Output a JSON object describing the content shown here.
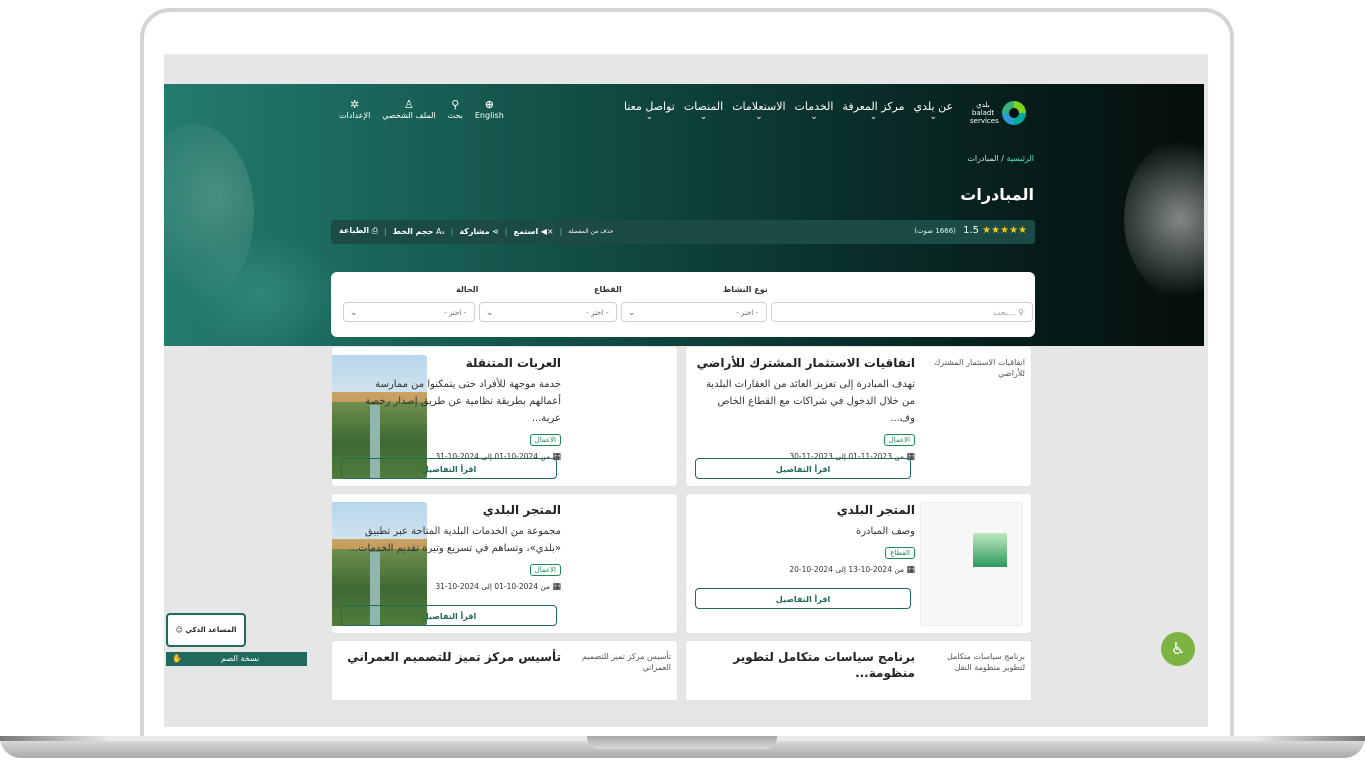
{
  "header": {
    "logo_text": "بلدي baladt services",
    "nav": [
      {
        "label": "عن بلدي"
      },
      {
        "label": "مركز المعرفة"
      },
      {
        "label": "الخدمات"
      },
      {
        "label": "الاستعلامات"
      },
      {
        "label": "المنصات"
      },
      {
        "label": "تواصل معنا"
      }
    ],
    "tools": {
      "language": "English",
      "search": "بحث",
      "profile": "الملف الشخصي",
      "settings": "الإعدادات"
    }
  },
  "breadcrumb": {
    "home": "الرئيسية",
    "separator": "/",
    "current": "المبادرات"
  },
  "page_title": "المبادرات",
  "rating": {
    "stars": "★★★★★",
    "score": "1.5",
    "votes": "(1666 صوت)"
  },
  "actions": {
    "favorite": "حذف من المفضلة",
    "listen": "استمع",
    "share": "مشاركة",
    "font_size": "حجم الخط",
    "print": "الطباعة"
  },
  "filter": {
    "search_placeholder": "بحث...",
    "activity_label": "نوع النشاط",
    "activity_value": "- اختر -",
    "sector_label": "القطاع",
    "sector_value": "- اختر -",
    "status_label": "الحالة",
    "status_value": "- اختر -"
  },
  "cards": [
    {
      "title": "اتفاقيات الاستثمار المشترك للأراضي",
      "desc": "تهدف المبادرة إلى تعزيز العائد من العقارات البلدية من خلال الدخول في شراكات مع القطاع الخاص وف...",
      "tag": "الاعمال",
      "dates": "من 2023-11-01 إلى 2023-11-30",
      "button": "اقرأ التفاصيل",
      "image_alt": "اتفاقيات الاستثمار المشترك للأراضي"
    },
    {
      "title": "العربات المتنقلة",
      "desc": "خدمة موجهة للأفراد حتى يتمكنوا من ممارسة أعمالهم بطريقة نظامية عن طريق إصدار رخصة عربة...",
      "tag": "الاعمال",
      "dates": "من 2024-10-01 إلى 2024-10-31",
      "button": "اقرأ التفاصيل"
    },
    {
      "title": "المتجر البلدي",
      "desc": "وصف المبادرة",
      "tag": "القطاع",
      "dates": "من 2024-10-13 إلى 2024-10-20",
      "button": "اقرأ التفاصيل"
    },
    {
      "title": "المتجر البلدي",
      "desc": "مجموعة من الخدمات البلدية المتاحة عبر تطبيق «بلدي»، وتساهم في تسريع وتيرة تقديم الخدمات...",
      "tag": "الاعمال",
      "dates": "من 2024-10-01 إلى 2024-10-31",
      "button": "اقرأ التفاصيل"
    },
    {
      "title": "برنامج سياسات متكامل لتطوير منظومة...",
      "image_alt": "برنامج سياسات متكامل لتطوير منظومة النقل"
    },
    {
      "title": "تأسيس مركز تميز للتصميم العمراني",
      "image_alt": "تأسيس مركز تميز للتصميم العمراني"
    }
  ],
  "floating": {
    "assistant": "المساعد الذكي",
    "deaf_version": "نسخة الصم"
  },
  "colors": {
    "primary": "#1f6a5c",
    "accent": "#7cb342",
    "star": "#f5c518"
  }
}
